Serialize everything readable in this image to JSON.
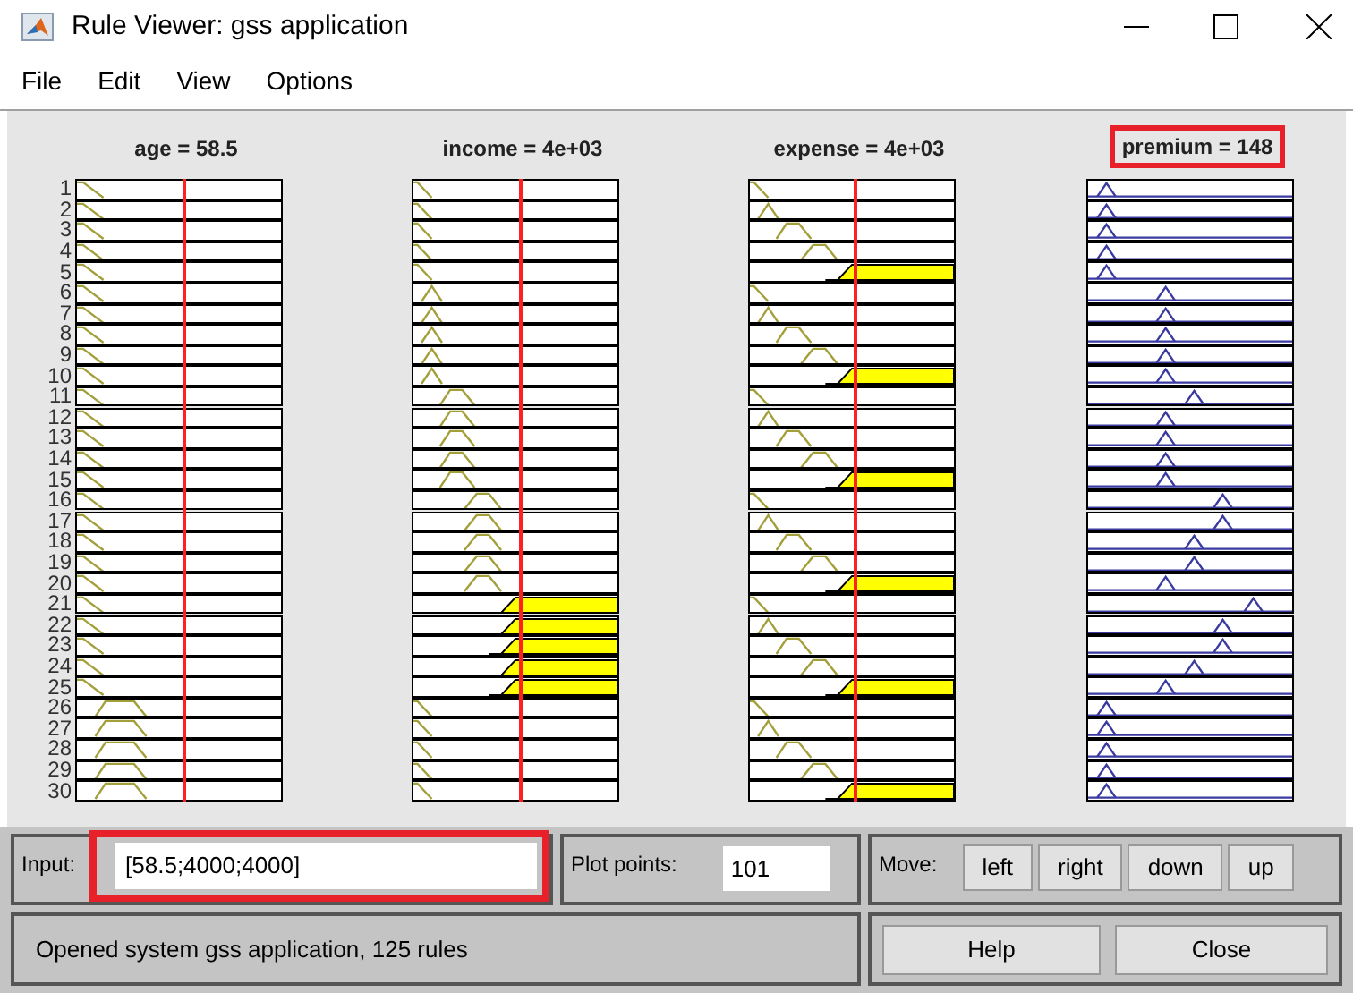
{
  "window": {
    "title": "Rule Viewer: gss application"
  },
  "menu": [
    "File",
    "Edit",
    "View",
    "Options"
  ],
  "columns": [
    {
      "title": "age = 58.5",
      "kind": "input",
      "highlighted": false
    },
    {
      "title": "income = 4e+03",
      "kind": "input",
      "highlighted": false
    },
    {
      "title": "expense = 4e+03",
      "kind": "input",
      "highlighted": false
    },
    {
      "title": "premium = 148",
      "kind": "output",
      "highlighted": true
    }
  ],
  "rules": [
    {
      "number": "1",
      "cells": [
        {
          "kind": "young"
        },
        {
          "kind": "lowest"
        },
        {
          "kind": "lowest"
        },
        {
          "kind": "lowest"
        }
      ]
    },
    {
      "number": "2",
      "cells": [
        {
          "kind": "young"
        },
        {
          "kind": "lowest"
        },
        {
          "kind": "low"
        },
        {
          "kind": "lowest"
        }
      ]
    },
    {
      "number": "3",
      "cells": [
        {
          "kind": "young"
        },
        {
          "kind": "lowest"
        },
        {
          "kind": "medium"
        },
        {
          "kind": "lowest"
        }
      ]
    },
    {
      "number": "4",
      "cells": [
        {
          "kind": "young"
        },
        {
          "kind": "lowest"
        },
        {
          "kind": "high"
        },
        {
          "kind": "lowest"
        }
      ]
    },
    {
      "number": "5",
      "cells": [
        {
          "kind": "young"
        },
        {
          "kind": "lowest"
        },
        {
          "kind": "highest"
        },
        {
          "kind": "lowest"
        }
      ]
    },
    {
      "number": "6",
      "cells": [
        {
          "kind": "young"
        },
        {
          "kind": "low"
        },
        {
          "kind": "lowest"
        },
        {
          "kind": "low"
        }
      ]
    },
    {
      "number": "7",
      "cells": [
        {
          "kind": "young"
        },
        {
          "kind": "low"
        },
        {
          "kind": "low"
        },
        {
          "kind": "low"
        }
      ]
    },
    {
      "number": "8",
      "cells": [
        {
          "kind": "young"
        },
        {
          "kind": "low"
        },
        {
          "kind": "medium"
        },
        {
          "kind": "low"
        }
      ]
    },
    {
      "number": "9",
      "cells": [
        {
          "kind": "young"
        },
        {
          "kind": "low"
        },
        {
          "kind": "high"
        },
        {
          "kind": "low"
        }
      ]
    },
    {
      "number": "10",
      "cells": [
        {
          "kind": "young"
        },
        {
          "kind": "low"
        },
        {
          "kind": "highest"
        },
        {
          "kind": "low"
        }
      ]
    },
    {
      "number": "11",
      "cells": [
        {
          "kind": "young"
        },
        {
          "kind": "medium"
        },
        {
          "kind": "lowest"
        },
        {
          "kind": "medium"
        }
      ]
    },
    {
      "number": "12",
      "cells": [
        {
          "kind": "young"
        },
        {
          "kind": "medium"
        },
        {
          "kind": "low"
        },
        {
          "kind": "low"
        }
      ]
    },
    {
      "number": "13",
      "cells": [
        {
          "kind": "young"
        },
        {
          "kind": "medium"
        },
        {
          "kind": "medium"
        },
        {
          "kind": "low"
        }
      ]
    },
    {
      "number": "14",
      "cells": [
        {
          "kind": "young"
        },
        {
          "kind": "medium"
        },
        {
          "kind": "high"
        },
        {
          "kind": "low"
        }
      ]
    },
    {
      "number": "15",
      "cells": [
        {
          "kind": "young"
        },
        {
          "kind": "medium"
        },
        {
          "kind": "highest"
        },
        {
          "kind": "low"
        }
      ]
    },
    {
      "number": "16",
      "cells": [
        {
          "kind": "young"
        },
        {
          "kind": "high"
        },
        {
          "kind": "lowest"
        },
        {
          "kind": "high"
        }
      ]
    },
    {
      "number": "17",
      "cells": [
        {
          "kind": "young"
        },
        {
          "kind": "high"
        },
        {
          "kind": "low"
        },
        {
          "kind": "high"
        }
      ]
    },
    {
      "number": "18",
      "cells": [
        {
          "kind": "young"
        },
        {
          "kind": "high"
        },
        {
          "kind": "medium"
        },
        {
          "kind": "medium"
        }
      ]
    },
    {
      "number": "19",
      "cells": [
        {
          "kind": "young"
        },
        {
          "kind": "high"
        },
        {
          "kind": "high"
        },
        {
          "kind": "medium"
        }
      ]
    },
    {
      "number": "20",
      "cells": [
        {
          "kind": "young"
        },
        {
          "kind": "high"
        },
        {
          "kind": "highest"
        },
        {
          "kind": "low"
        }
      ]
    },
    {
      "number": "21",
      "cells": [
        {
          "kind": "young"
        },
        {
          "kind": "highest"
        },
        {
          "kind": "lowest"
        },
        {
          "kind": "highest"
        }
      ]
    },
    {
      "number": "22",
      "cells": [
        {
          "kind": "young"
        },
        {
          "kind": "highest"
        },
        {
          "kind": "low"
        },
        {
          "kind": "high"
        }
      ]
    },
    {
      "number": "23",
      "cells": [
        {
          "kind": "young"
        },
        {
          "kind": "highest"
        },
        {
          "kind": "medium"
        },
        {
          "kind": "high"
        }
      ]
    },
    {
      "number": "24",
      "cells": [
        {
          "kind": "young"
        },
        {
          "kind": "highest"
        },
        {
          "kind": "high"
        },
        {
          "kind": "medium"
        }
      ]
    },
    {
      "number": "25",
      "cells": [
        {
          "kind": "young"
        },
        {
          "kind": "highest"
        },
        {
          "kind": "highest"
        },
        {
          "kind": "low"
        }
      ]
    },
    {
      "number": "26",
      "cells": [
        {
          "kind": "middle"
        },
        {
          "kind": "lowest"
        },
        {
          "kind": "lowest"
        },
        {
          "kind": "lowest"
        }
      ]
    },
    {
      "number": "27",
      "cells": [
        {
          "kind": "middle"
        },
        {
          "kind": "lowest"
        },
        {
          "kind": "low"
        },
        {
          "kind": "lowest"
        }
      ]
    },
    {
      "number": "28",
      "cells": [
        {
          "kind": "middle"
        },
        {
          "kind": "lowest"
        },
        {
          "kind": "medium"
        },
        {
          "kind": "lowest"
        }
      ]
    },
    {
      "number": "29",
      "cells": [
        {
          "kind": "middle"
        },
        {
          "kind": "lowest"
        },
        {
          "kind": "high"
        },
        {
          "kind": "lowest"
        }
      ]
    },
    {
      "number": "30",
      "cells": [
        {
          "kind": "middle"
        },
        {
          "kind": "lowest"
        },
        {
          "kind": "highest"
        },
        {
          "kind": "lowest"
        }
      ]
    }
  ],
  "input": {
    "label": "Input:",
    "value": "[58.5;4000;4000]",
    "highlighted": true
  },
  "plot_points": {
    "label": "Plot points:",
    "value": "101"
  },
  "move": {
    "label": "Move:",
    "buttons": [
      "left",
      "right",
      "down",
      "up"
    ]
  },
  "status": "Opened system gss application, 125 rules",
  "buttons": [
    "Help",
    "Close"
  ]
}
